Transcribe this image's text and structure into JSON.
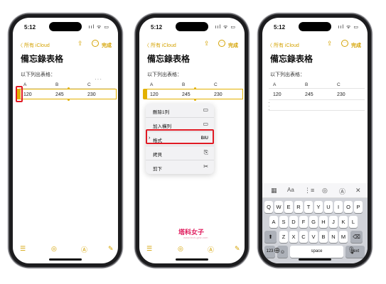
{
  "status": {
    "time": "5:12",
    "icons": "ııl ᯤ ▭"
  },
  "nav": {
    "back": "〈 所有 iCloud",
    "share_icon": "⇪",
    "more_icon": "···",
    "done": "完成"
  },
  "note": {
    "title": "備忘錄表格",
    "text": "以下列出表格：",
    "dots": "···"
  },
  "table": {
    "headers": [
      "A",
      "B",
      "C"
    ],
    "row": [
      "120",
      "245",
      "230"
    ]
  },
  "menu": {
    "items": [
      {
        "label": "刪除1列",
        "icon": "▭"
      },
      {
        "label": "加入橫列",
        "icon": "▭"
      },
      {
        "label": "格式",
        "icon": "BIU",
        "prefix": "›"
      },
      {
        "label": "拷貝",
        "icon": "⎘"
      },
      {
        "label": "剪下",
        "icon": "✂"
      }
    ]
  },
  "watermark": {
    "text": "塔科女子",
    "sub": "www.tech-girlz.com"
  },
  "bottom_icons": {
    "left": "☰",
    "camera": "◎",
    "pen": "Ⓐ",
    "compose": "✎"
  },
  "keyboard": {
    "tools": [
      "▦",
      "Aa",
      "⋮≡",
      "◎",
      "Ⓐ",
      "✕"
    ],
    "row1": [
      "Q",
      "W",
      "E",
      "R",
      "T",
      "Y",
      "U",
      "I",
      "O",
      "P"
    ],
    "row2": [
      "A",
      "S",
      "D",
      "F",
      "G",
      "H",
      "J",
      "K",
      "L"
    ],
    "row3": [
      "Z",
      "X",
      "C",
      "V",
      "B",
      "N",
      "M"
    ],
    "shift": "⬆",
    "delete": "⌫",
    "num": "123",
    "emoji": "☺",
    "space": "space",
    "next": "next",
    "globe": "⊕",
    "mic": "🎙"
  },
  "colors": {
    "accent": "#d4a200",
    "highlight": "#e01a24",
    "selection": "#e3b100"
  }
}
